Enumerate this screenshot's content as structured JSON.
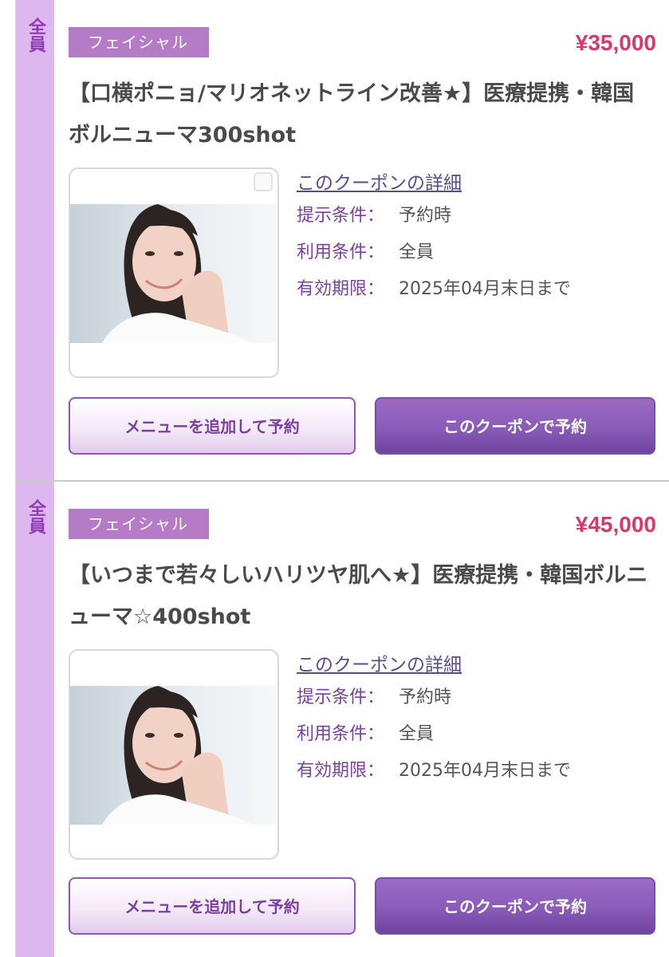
{
  "coupons": [
    {
      "target_tag": "全員",
      "category": "フェイシャル",
      "price": "¥35,000",
      "title": "【口横ポニョ/マリオネットライン改善★】医療提携・韓国ボルニューマ300shot",
      "details_link": "このクーポンの詳細",
      "conditions": [
        {
          "label": "提示条件：",
          "value": "予約時"
        },
        {
          "label": "利用条件：",
          "value": "全員"
        },
        {
          "label": "有効期限：",
          "value": "2025年04月末日まで"
        }
      ],
      "buttons": {
        "add_menu": "メニューを追加して予約",
        "book": "このクーポンで予約"
      }
    },
    {
      "target_tag": "全員",
      "category": "フェイシャル",
      "price": "¥45,000",
      "title": "【いつまで若々しいハリツヤ肌へ★】医療提携・韓国ボルニューマ☆400shot",
      "details_link": "このクーポンの詳細",
      "conditions": [
        {
          "label": "提示条件：",
          "value": "予約時"
        },
        {
          "label": "利用条件：",
          "value": "全員"
        },
        {
          "label": "有効期限：",
          "value": "2025年04月末日まで"
        }
      ],
      "buttons": {
        "add_menu": "メニューを追加して予約",
        "book": "このクーポンで予約"
      }
    }
  ],
  "colors": {
    "side_tag_bg": "#ddb8ee",
    "side_tag_text": "#8e3db5",
    "category_bg": "#b57bc6",
    "price": "#d43a6a",
    "accent_button": "#8a5bb8"
  },
  "icons": {
    "photo_corner": "overlay-square-icon"
  }
}
